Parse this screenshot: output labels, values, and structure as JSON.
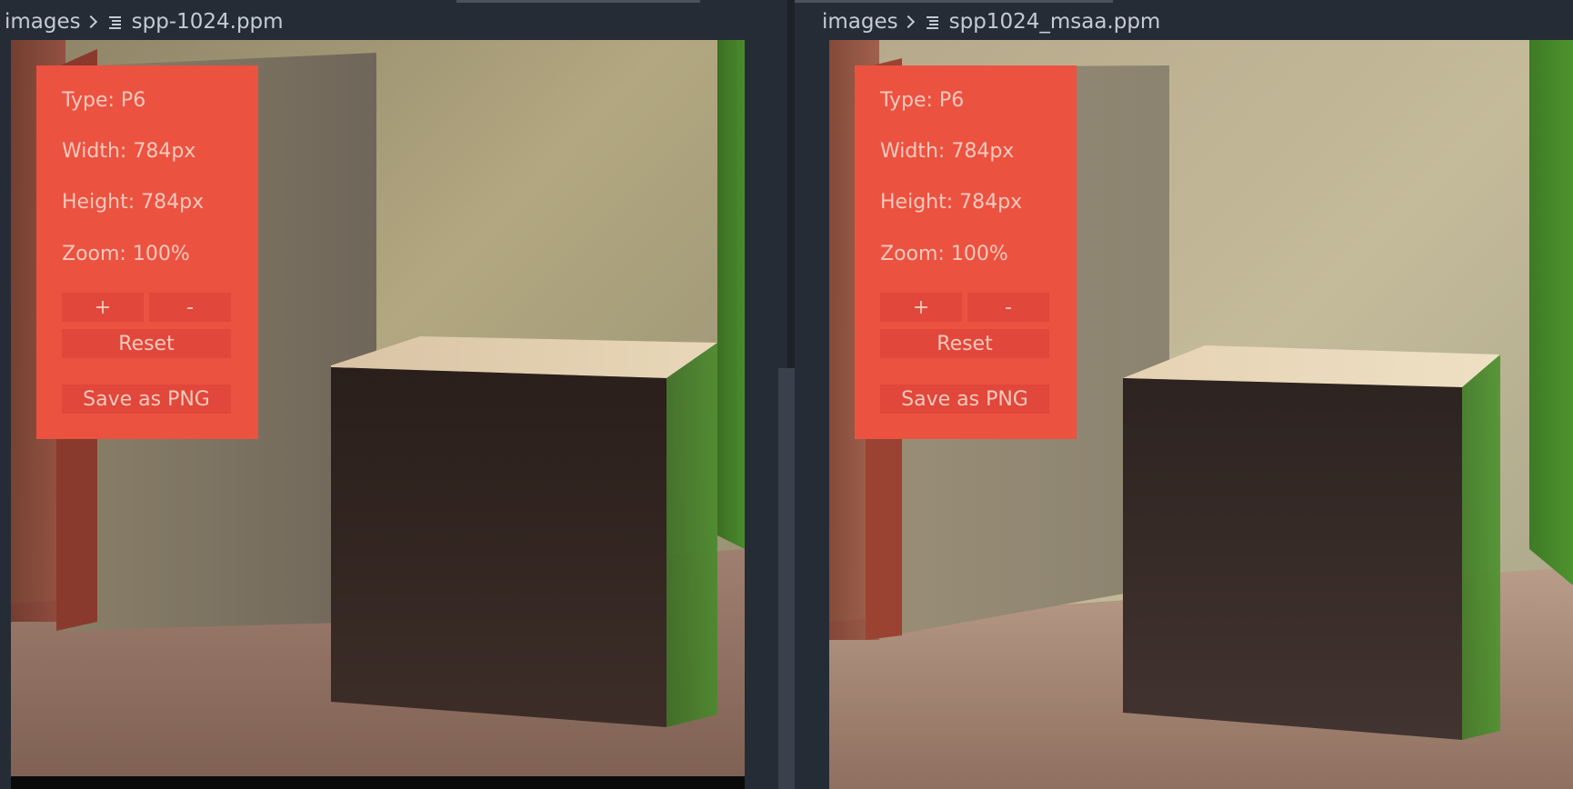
{
  "left_pane": {
    "breadcrumb": {
      "folder": "images",
      "separator_icon": "chevron-right-icon",
      "file_icon": "lines-file-icon",
      "filename": "spp-1024.ppm"
    },
    "info": {
      "type": "Type: P6",
      "width": "Width: 784px",
      "height": "Height: 784px",
      "zoom": "Zoom: 100%"
    },
    "buttons": {
      "zoom_in": "+",
      "zoom_out": "-",
      "reset": "Reset",
      "save": "Save as PNG"
    }
  },
  "right_pane": {
    "breadcrumb": {
      "folder": "images",
      "separator_icon": "chevron-right-icon",
      "file_icon": "lines-file-icon",
      "filename": "spp1024_msaa.ppm"
    },
    "info": {
      "type": "Type: P6",
      "width": "Width: 784px",
      "height": "Height: 784px",
      "zoom": "Zoom: 100%"
    },
    "buttons": {
      "zoom_in": "+",
      "zoom_out": "-",
      "reset": "Reset",
      "save": "Save as PNG"
    }
  },
  "colors": {
    "overlay_bg": "#ec5240",
    "overlay_text": "#f6c9bd",
    "button_bg": "#e1473a",
    "editor_bg": "#262c35",
    "wall_green": "#3f8a2a",
    "wall_red": "#8e3a2b"
  }
}
